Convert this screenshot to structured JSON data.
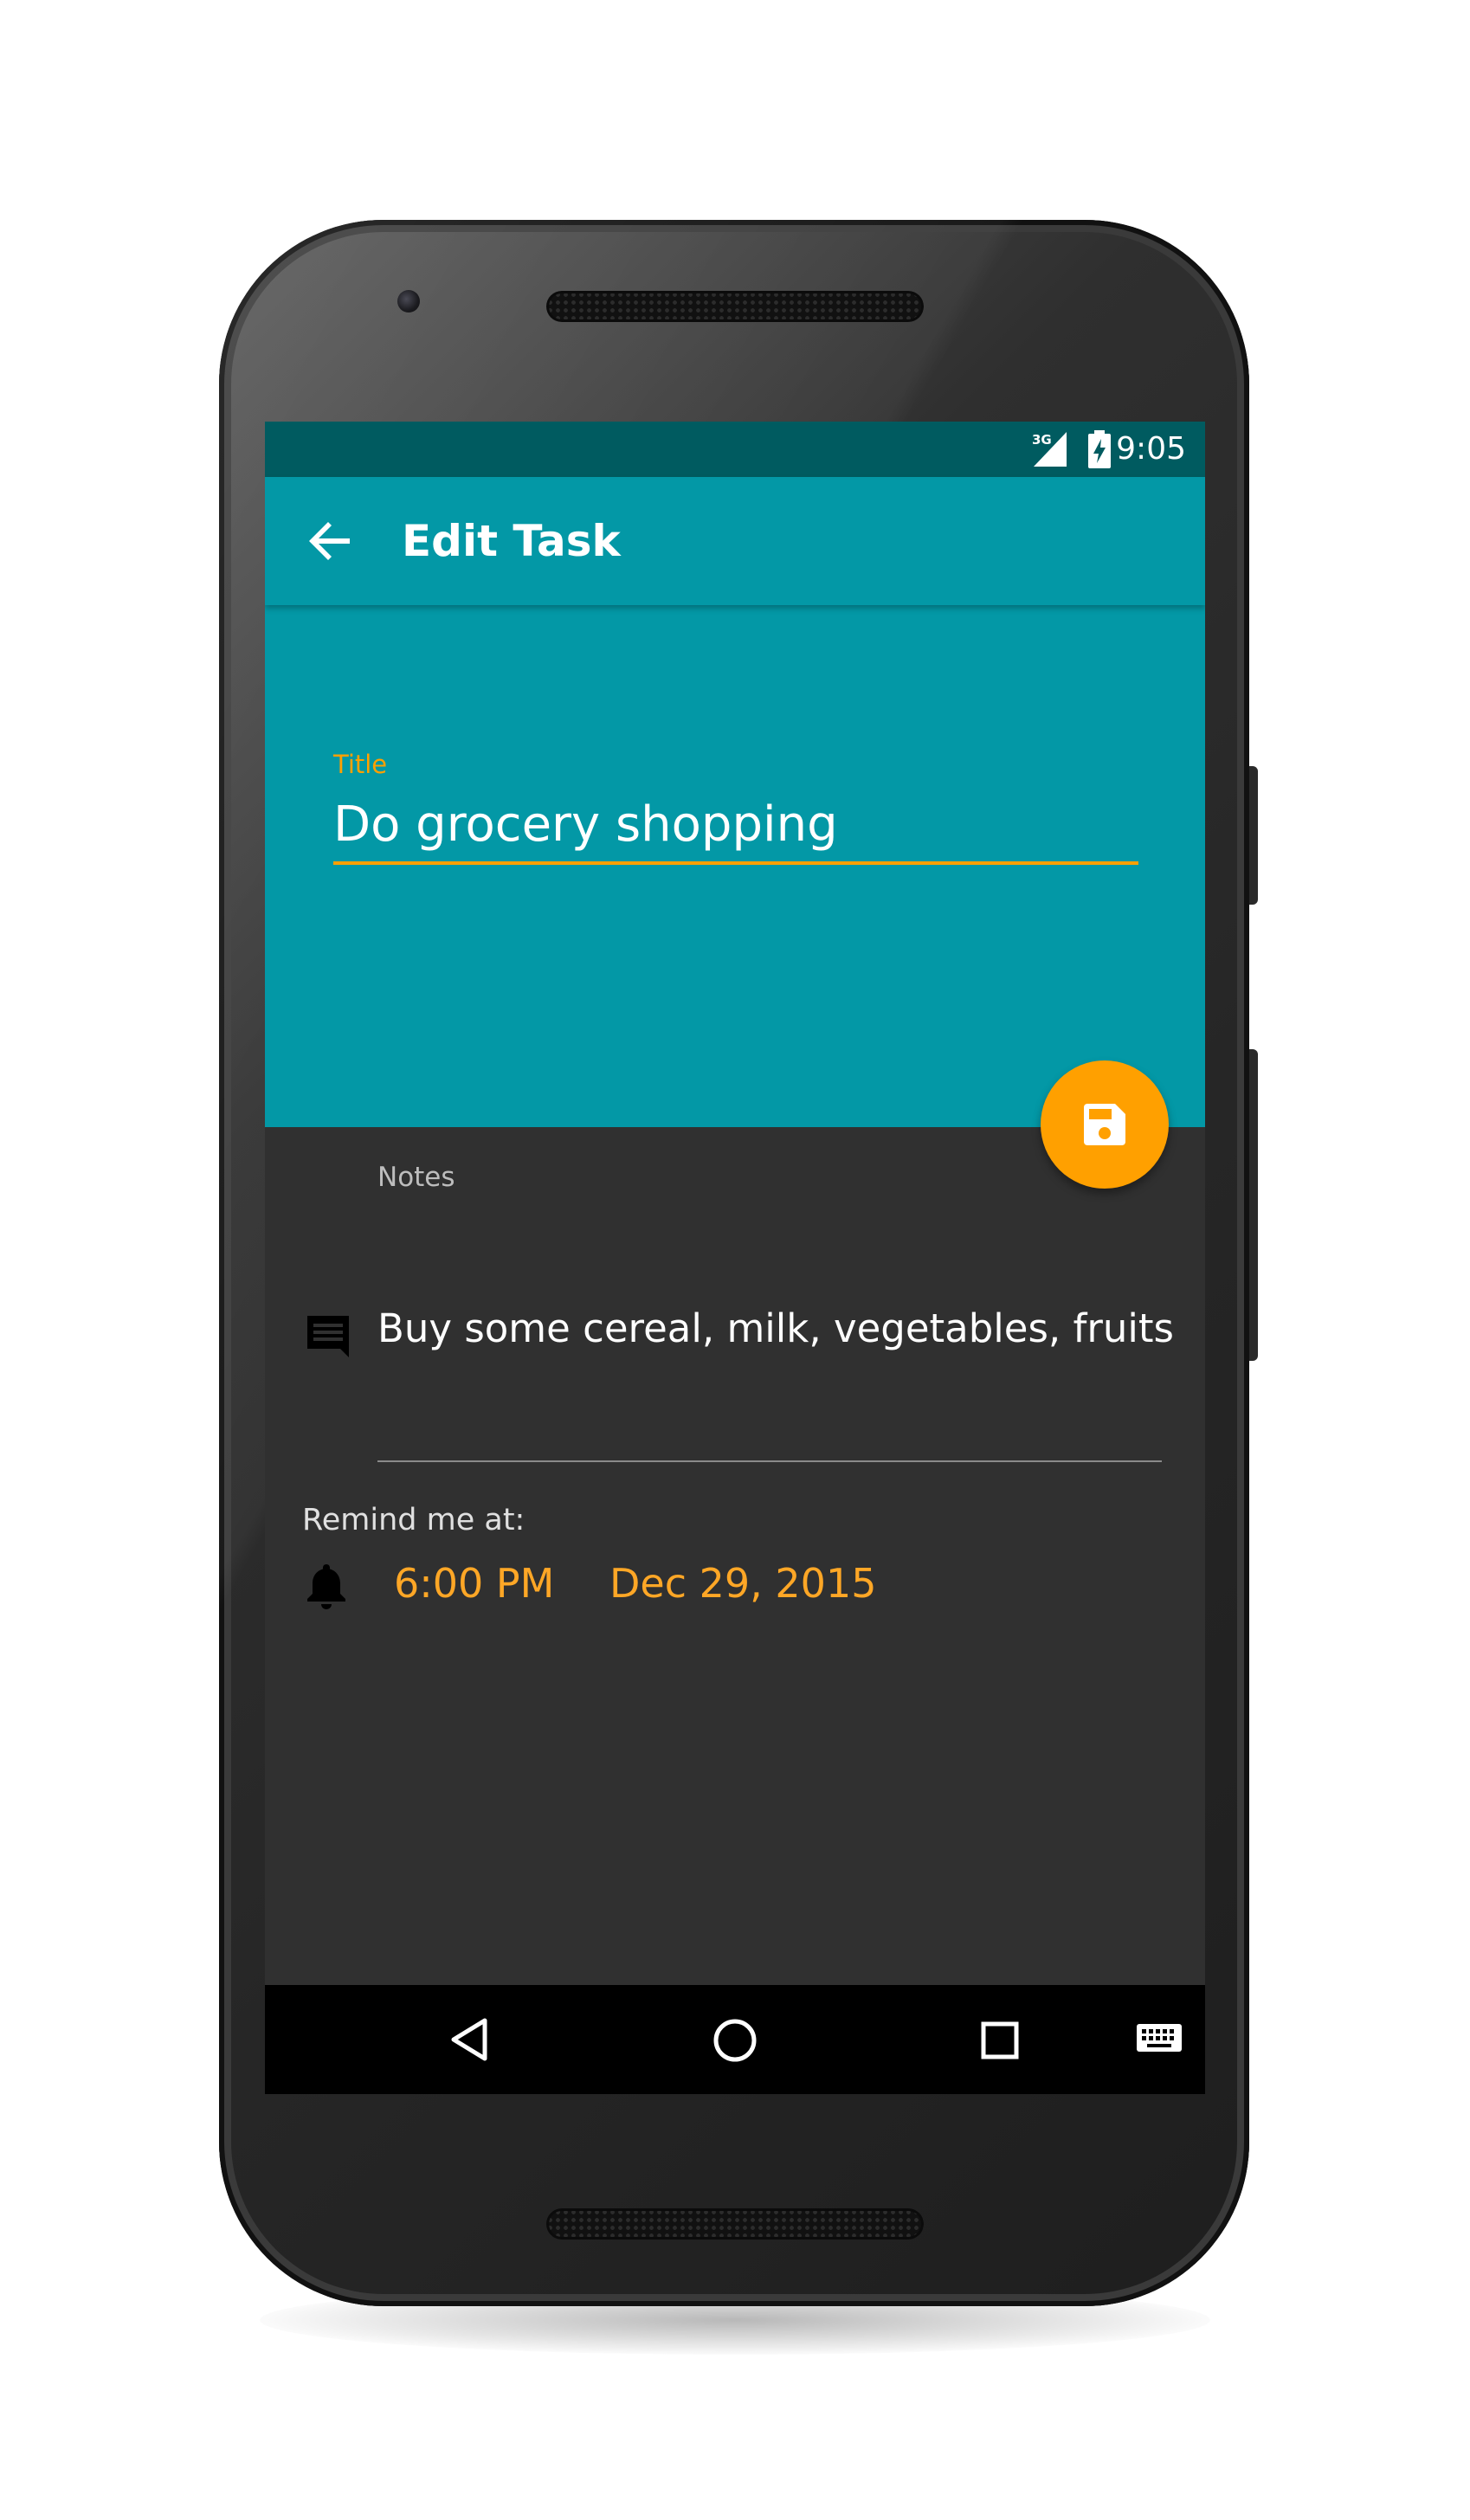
{
  "status_bar": {
    "time": "9:05",
    "network": "3G",
    "icons": [
      "signal-3g-icon",
      "battery-charging-icon"
    ]
  },
  "app_bar": {
    "back_icon": "arrow-back-icon",
    "title": "Edit Task"
  },
  "form": {
    "title_label": "Title",
    "title_value": "Do grocery shopping",
    "notes_label": "Notes",
    "notes_value": "Buy some cereal, milk, vegetables, fruits",
    "notes_icon": "comment-icon",
    "remind_label": "Remind me at:",
    "remind_icon": "bell-icon",
    "remind_time": "6:00 PM",
    "remind_date": "Dec 29, 2015"
  },
  "fab": {
    "icon": "save-icon"
  },
  "nav_bar": {
    "icons": [
      "back-triangle-icon",
      "home-circle-icon",
      "recents-square-icon",
      "keyboard-icon"
    ]
  },
  "colors": {
    "primary": "#0398a6",
    "primary_dark": "#005b60",
    "accent": "#ffa000",
    "background": "#303030"
  }
}
